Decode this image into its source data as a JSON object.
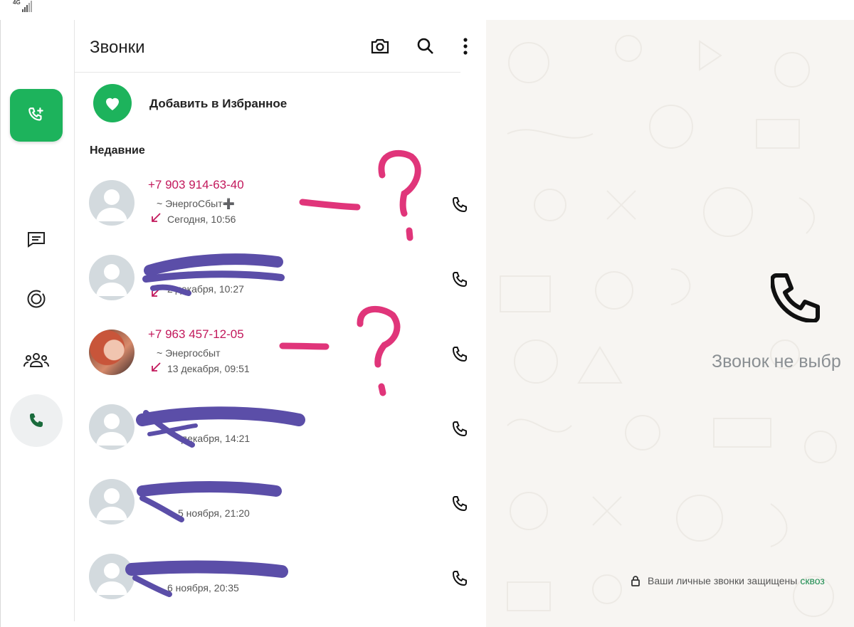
{
  "status_bar": {
    "network": "4G"
  },
  "colors": {
    "accent": "#1db35c",
    "missed_call": "#c2185b",
    "scribble": "#5b4ea8",
    "annotation": "#e0357a"
  },
  "rail": {
    "new_call_icon": "add-call-icon",
    "items": [
      {
        "name": "chats",
        "icon": "chat-icon"
      },
      {
        "name": "status",
        "icon": "status-icon"
      },
      {
        "name": "communities",
        "icon": "communities-icon"
      },
      {
        "name": "calls",
        "icon": "phone-icon",
        "active": true
      }
    ]
  },
  "header": {
    "title": "Звонки",
    "icons": [
      "camera-icon",
      "search-icon",
      "more-vertical-icon"
    ]
  },
  "favorites": {
    "label": "Добавить в Избранное",
    "icon": "heart-icon"
  },
  "section_recent": "Недавние",
  "calls": [
    {
      "name": "+7 903 914-63-40",
      "sub": "~ ЭнергоСбыт➕",
      "time": "Сегодня, 10:56",
      "direction": "incoming-missed"
    },
    {
      "name": "",
      "sub": "",
      "time": "2 декабря, 10:27",
      "direction": "incoming-missed"
    },
    {
      "name": "+7 963 457-12-05",
      "sub": "~ Энергосбыт",
      "time": "13 декабря, 09:51",
      "direction": "incoming-missed"
    },
    {
      "name": "",
      "sub": "",
      "time": "декабря, 14:21",
      "direction": "incoming-missed"
    },
    {
      "name": "",
      "sub": "",
      "time": "5 ноября, 21:20",
      "direction": "incoming-missed"
    },
    {
      "name": "",
      "sub": "",
      "time": "6 ноября, 20:35",
      "direction": "incoming-missed"
    }
  ],
  "empty_state": {
    "text": "Звонок не выбр",
    "icon": "phone-icon"
  },
  "footer": {
    "text": "Ваши личные звонки защищены",
    "link": "сквоз",
    "icon": "lock-icon"
  }
}
